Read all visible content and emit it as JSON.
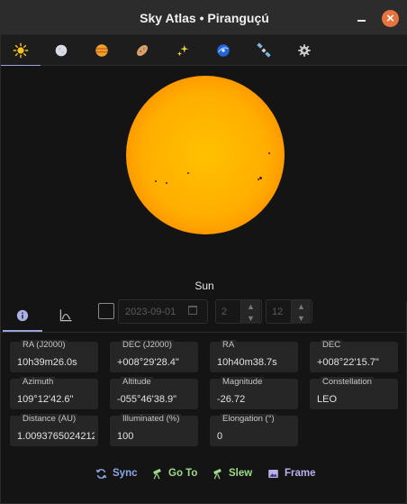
{
  "window": {
    "title": "Sky Atlas  •  Piranguçú"
  },
  "tabs": [
    {
      "icon": "sun-icon"
    },
    {
      "icon": "moon-icon"
    },
    {
      "icon": "planet-icon"
    },
    {
      "icon": "comet-icon"
    },
    {
      "icon": "stars-icon"
    },
    {
      "icon": "galaxy-icon"
    },
    {
      "icon": "satellite-icon"
    },
    {
      "icon": "gear-icon"
    }
  ],
  "viewer": {
    "object_name": "Sun"
  },
  "controls": {
    "date_value": "2023-09-01",
    "hour_value": "2",
    "minute_value": "12"
  },
  "fields": [
    {
      "label": "RA (J2000)",
      "value": "10h39m26.0s"
    },
    {
      "label": "DEC (J2000)",
      "value": "+008°29'28.4\""
    },
    {
      "label": "RA",
      "value": "10h40m38.7s"
    },
    {
      "label": "DEC",
      "value": "+008°22'15.7\""
    },
    {
      "label": "Azimuth",
      "value": "109°12'42.6\""
    },
    {
      "label": "Altitude",
      "value": "-055°46'38.9\""
    },
    {
      "label": "Magnitude",
      "value": "-26.72"
    },
    {
      "label": "Constellation",
      "value": "LEO"
    },
    {
      "label": "Distance (AU)",
      "value": "1.0093765024212:"
    },
    {
      "label": "Illuminated (%)",
      "value": "100"
    },
    {
      "label": "Elongation (°)",
      "value": "0"
    }
  ],
  "actions": {
    "sync": "Sync",
    "goto": "Go To",
    "slew": "Slew",
    "frame": "Frame"
  },
  "colors": {
    "accent": "#9aa3d8",
    "sync": "#8aa8e8",
    "goto": "#9edb8a",
    "slew": "#9edb8a",
    "frame": "#b9b1ee",
    "close": "#e9733f"
  }
}
